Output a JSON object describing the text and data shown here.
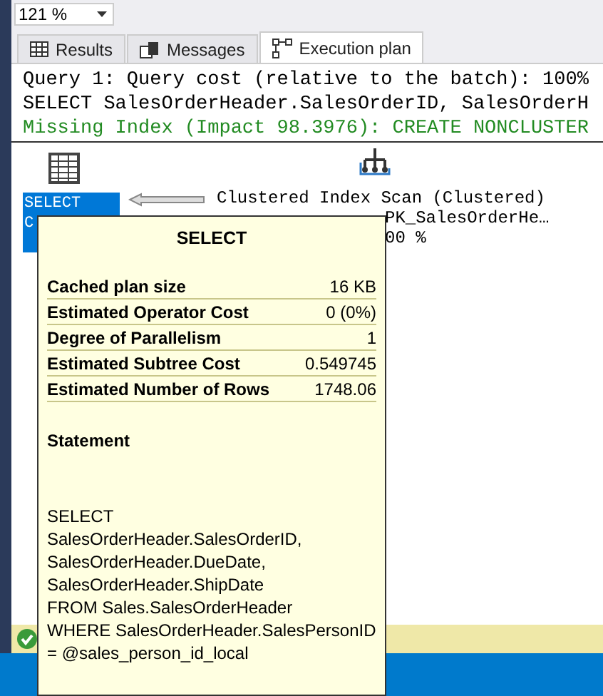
{
  "toolbar": {
    "zoom": "121 %"
  },
  "tabs": [
    {
      "label": "Results",
      "selected": false
    },
    {
      "label": "Messages",
      "selected": false
    },
    {
      "label": "Execution plan",
      "selected": true
    }
  ],
  "query_text": [
    {
      "text": "Query 1: Query cost (relative to the batch): 100%",
      "kind": "plain"
    },
    {
      "text": "SELECT SalesOrderHeader.SalesOrderID, SalesOrderH",
      "kind": "plain"
    },
    {
      "text": "Missing Index (Impact 98.3976): CREATE NONCLUSTER",
      "kind": "hint"
    }
  ],
  "plan": {
    "select_node": {
      "label": "SELECT",
      "cost": "C",
      "selected": true
    },
    "scan_node": {
      "label": "Clustered Index Scan (Clustered)",
      "object": "PK_SalesOrderHe…",
      "cost": "00 %"
    }
  },
  "tooltip": {
    "title": "SELECT",
    "properties": [
      {
        "name": "Cached plan size",
        "value": "16 KB"
      },
      {
        "name": "Estimated Operator Cost",
        "value": "0 (0%)"
      },
      {
        "name": "Degree of Parallelism",
        "value": "1"
      },
      {
        "name": "Estimated Subtree Cost",
        "value": "0.549745"
      },
      {
        "name": "Estimated Number of Rows",
        "value": "1748.06"
      }
    ],
    "statement_heading": "Statement",
    "statement_lines": [
      "SELECT",
      "SalesOrderHeader.SalesOrderID,",
      "SalesOrderHeader.DueDate,",
      "SalesOrderHeader.ShipDate",
      "FROM Sales.SalesOrderHeader",
      "WHERE SalesOrderHeader.SalesPersonID",
      "= @sales_person_id_local"
    ]
  }
}
